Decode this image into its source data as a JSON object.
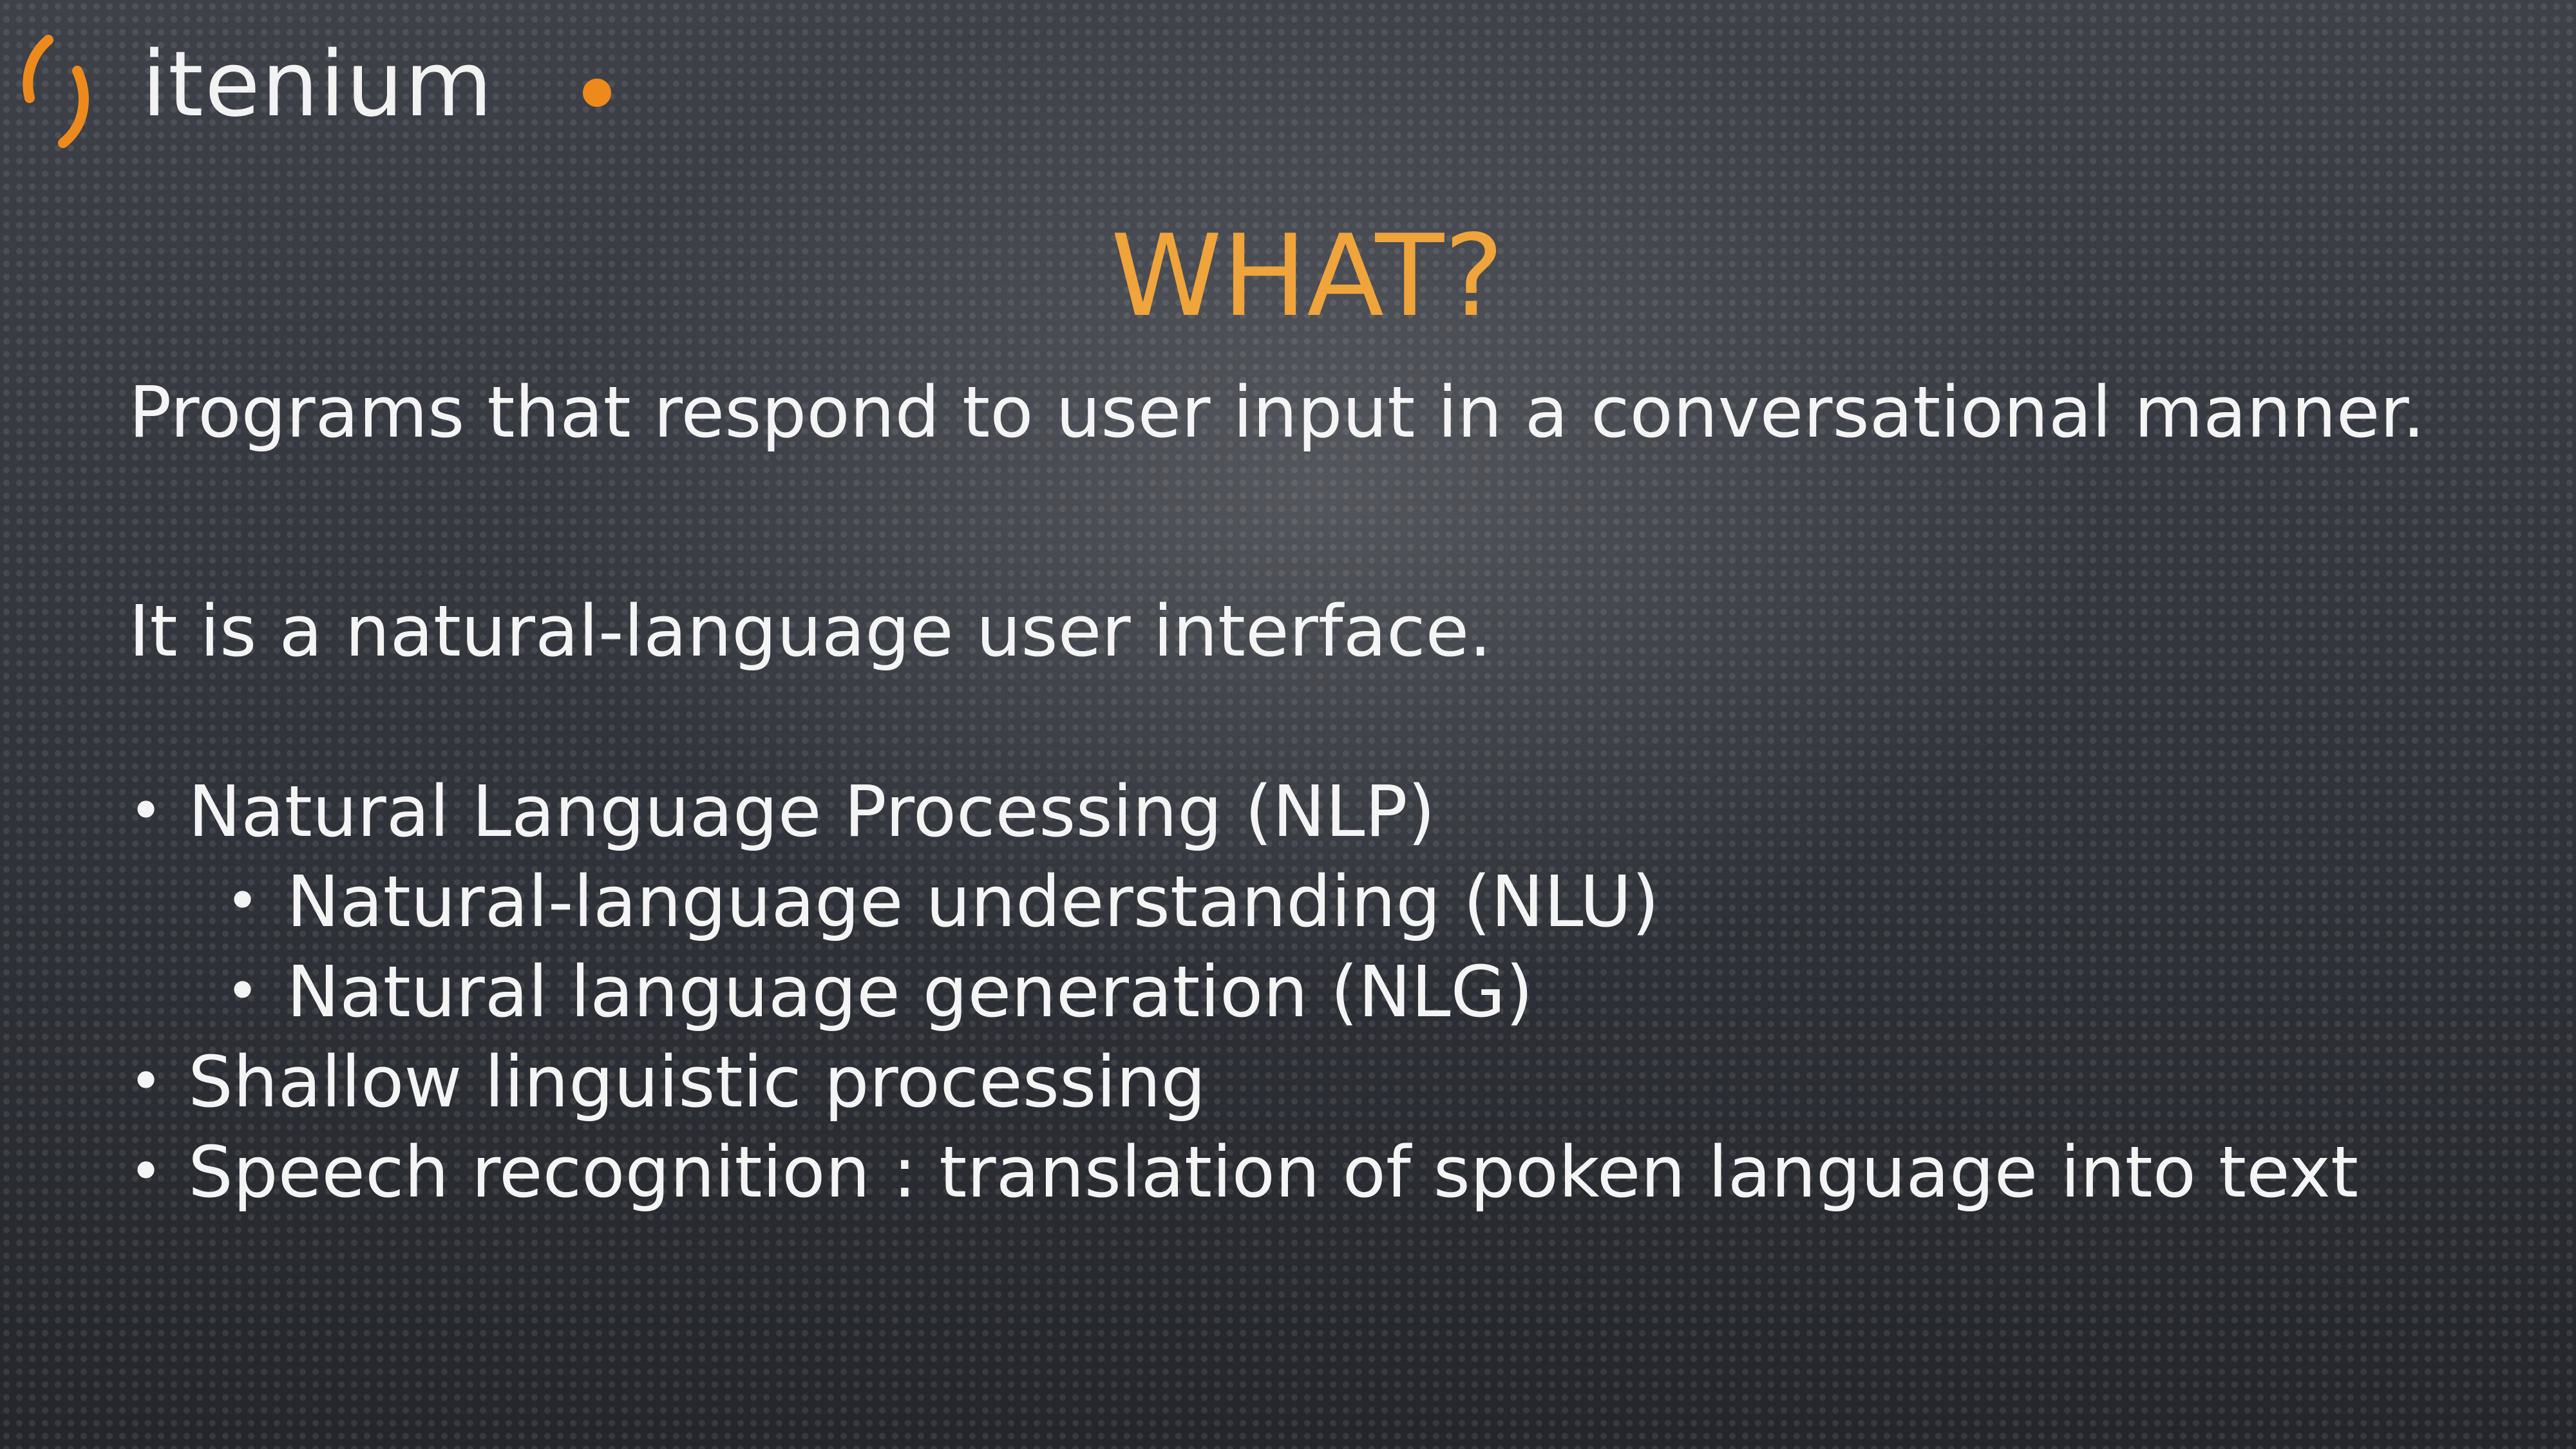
{
  "logo": {
    "wordmark": "itenium",
    "mark_icon": "bracket-swoosh-icon",
    "accent_color": "#ee8a1c"
  },
  "slide": {
    "title": "WHAT?",
    "title_color": "#efa43c",
    "paragraph_1": "Programs that respond to user input in a conversational manner.",
    "paragraph_2": "It is a natural-language user interface.",
    "bullet_glyph": "•",
    "bullets": [
      {
        "text": "Natural Language Processing (NLP)",
        "level": 1
      },
      {
        "text": "Natural-language understanding (NLU)",
        "level": 2
      },
      {
        "text": "Natural language generation (NLG)",
        "level": 2
      },
      {
        "text": "Shallow linguistic processing",
        "level": 1
      },
      {
        "text": "Speech recognition : translation of spoken language into text",
        "level": 1
      }
    ]
  }
}
